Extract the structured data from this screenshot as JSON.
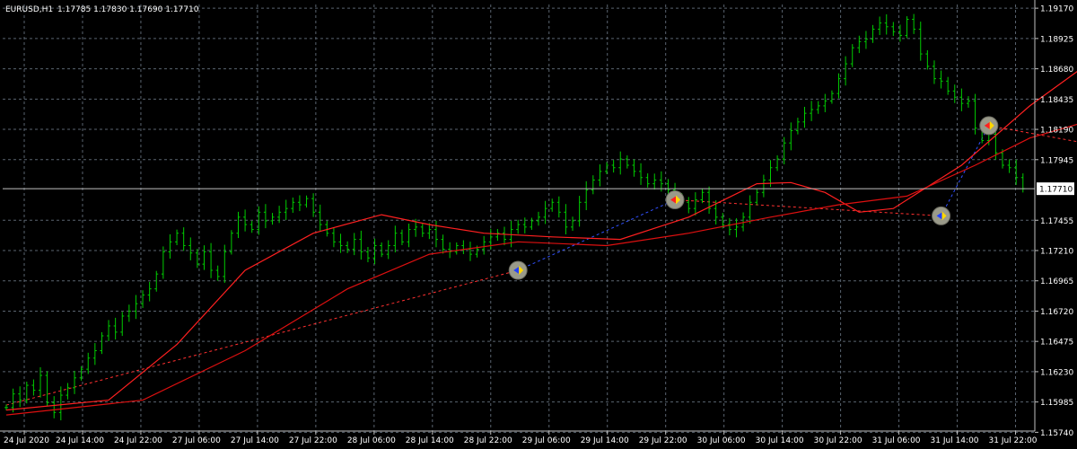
{
  "header": {
    "symbol_timeframe": "EURUSD,H1",
    "ohlc": "1.17785 1.17830 1.17690 1.17710"
  },
  "colors": {
    "background": "#000000",
    "grid": "#5a6470",
    "bars": "#00cc00",
    "ma_fast": "#ff2020",
    "ma_slow": "#dd1010",
    "trade_line_buy": "#3050ff",
    "trade_line_sell": "#ff3030",
    "current_price_line": "#c0c0c0",
    "axis": "#c0c0c0",
    "text": "#ffffff"
  },
  "chart_data": {
    "type": "ohlc",
    "timeframe": "H1",
    "ylim": [
      1.1575,
      1.192
    ],
    "y_ticks": [
      "1.19170",
      "1.18925",
      "1.18680",
      "1.18435",
      "1.18190",
      "1.17945",
      "1.17455",
      "1.17210",
      "1.16965",
      "1.16720",
      "1.16475",
      "1.16230",
      "1.15985",
      "1.15740"
    ],
    "x_ticks": [
      "24 Jul 2020",
      "24 Jul 14:00",
      "24 Jul 22:00",
      "27 Jul 06:00",
      "27 Jul 14:00",
      "27 Jul 22:00",
      "28 Jul 06:00",
      "28 Jul 14:00",
      "28 Jul 22:00",
      "29 Jul 06:00",
      "29 Jul 14:00",
      "29 Jul 22:00",
      "30 Jul 06:00",
      "30 Jul 14:00",
      "30 Jul 22:00",
      "31 Jul 06:00",
      "31 Jul 14:00",
      "31 Jul 22:00"
    ],
    "current_price": "1.17710",
    "current_price_value": 1.1771,
    "closes": [
      1.1594,
      1.1605,
      1.16,
      1.1612,
      1.1608,
      1.162,
      1.1598,
      1.159,
      1.1604,
      1.161,
      1.1618,
      1.1625,
      1.1634,
      1.164,
      1.1652,
      1.166,
      1.1655,
      1.1668,
      1.1672,
      1.1678,
      1.1685,
      1.169,
      1.1702,
      1.172,
      1.1728,
      1.1735,
      1.1725,
      1.1719,
      1.171,
      1.172,
      1.1705,
      1.17,
      1.172,
      1.1735,
      1.1748,
      1.1742,
      1.1738,
      1.1752,
      1.1745,
      1.1748,
      1.1752,
      1.1755,
      1.176,
      1.1758,
      1.1763,
      1.1752,
      1.1742,
      1.1735,
      1.1728,
      1.1725,
      1.1722,
      1.173,
      1.172,
      1.1715,
      1.1725,
      1.1718,
      1.1725,
      1.1735,
      1.1728,
      1.1738,
      1.174,
      1.1735,
      1.1738,
      1.173,
      1.1722,
      1.172,
      1.1725,
      1.1722,
      1.1718,
      1.1722,
      1.1728,
      1.1732,
      1.1735,
      1.173,
      1.1738,
      1.1742,
      1.174,
      1.1745,
      1.1748,
      1.1755,
      1.176,
      1.1752,
      1.174,
      1.1745,
      1.176,
      1.177,
      1.1778,
      1.1785,
      1.179,
      1.1788,
      1.1795,
      1.179,
      1.1785,
      1.178,
      1.1775,
      1.1778,
      1.1775,
      1.177,
      1.1765,
      1.176,
      1.1755,
      1.1762,
      1.1768,
      1.1755,
      1.1748,
      1.1742,
      1.1738,
      1.174,
      1.1748,
      1.176,
      1.1768,
      1.1778,
      1.1788,
      1.1795,
      1.1808,
      1.1818,
      1.1825,
      1.1832,
      1.1835,
      1.1838,
      1.1842,
      1.1848,
      1.186,
      1.1872,
      1.1885,
      1.189,
      1.1892,
      1.19,
      1.1905,
      1.1902,
      1.1898,
      1.1895,
      1.1908,
      1.19,
      1.188,
      1.187,
      1.186,
      1.1858,
      1.185,
      1.1845,
      1.184,
      1.1842,
      1.182,
      1.181,
      1.1815,
      1.18,
      1.179,
      1.1788,
      1.178,
      1.1771
    ],
    "series": [
      {
        "points": [
          [
            0,
            1.1592
          ],
          [
            15,
            1.16
          ],
          [
            25,
            1.1645
          ],
          [
            35,
            1.1705
          ],
          [
            45,
            1.1735
          ],
          [
            55,
            1.175
          ],
          [
            62,
            1.1742
          ],
          [
            70,
            1.1735
          ],
          [
            80,
            1.1732
          ],
          [
            90,
            1.173
          ],
          [
            100,
            1.1748
          ],
          [
            110,
            1.1775
          ],
          [
            115,
            1.1776
          ],
          [
            120,
            1.1768
          ],
          [
            125,
            1.1752
          ],
          [
            130,
            1.1755
          ],
          [
            140,
            1.179
          ],
          [
            150,
            1.1838
          ],
          [
            158,
            1.187
          ],
          [
            162,
            1.188
          ],
          [
            167,
            1.1875
          ],
          [
            172,
            1.185
          ],
          [
            178,
            1.182
          ]
        ]
      },
      {
        "points": [
          [
            0,
            1.1588
          ],
          [
            20,
            1.16
          ],
          [
            35,
            1.164
          ],
          [
            50,
            1.169
          ],
          [
            62,
            1.1718
          ],
          [
            75,
            1.1728
          ],
          [
            88,
            1.1725
          ],
          [
            100,
            1.1735
          ],
          [
            112,
            1.1748
          ],
          [
            122,
            1.1758
          ],
          [
            132,
            1.1765
          ],
          [
            142,
            1.179
          ],
          [
            150,
            1.1812
          ],
          [
            160,
            1.1828
          ],
          [
            168,
            1.184
          ],
          [
            172,
            1.1843
          ],
          [
            178,
            1.1842
          ]
        ]
      }
    ],
    "trades": [
      {
        "entry_index": 75,
        "entry_price": 1.1705,
        "exit_index": 98,
        "exit_price": 1.1762,
        "direction": "buy"
      },
      {
        "entry_index": 98,
        "entry_price": 1.1762,
        "exit_index": 137,
        "exit_price": 1.1749,
        "direction": "sell"
      },
      {
        "entry_index": 137,
        "entry_price": 1.1749,
        "exit_index": 144,
        "exit_price": 1.1822,
        "direction": "buy"
      },
      {
        "entry_index": 144,
        "entry_price": 1.1822,
        "exit_index": 175,
        "exit_price": 1.1791,
        "direction": "sell"
      }
    ],
    "trade_line_pre": {
      "from_index": 0,
      "from_price": 1.1596,
      "to_index": 75,
      "to_price": 1.1705
    }
  }
}
